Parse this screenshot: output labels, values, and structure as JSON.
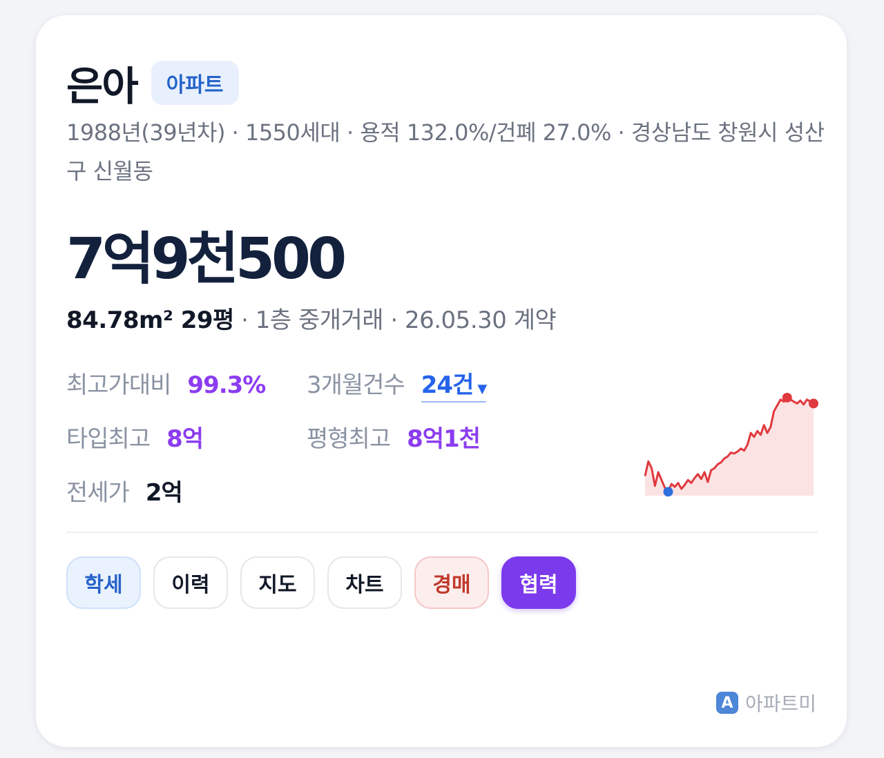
{
  "complex": {
    "name": "은아",
    "type_badge": "아파트",
    "description": "1988년(39년차) · 1550세대 · 용적 132.0%/건폐 27.0% · 경상남도 창원시 성산구 신월동"
  },
  "price": "7억9천500",
  "deal": {
    "area": "84.78m² 29평",
    "detail": " · 1층 중개거래 · 26.05.30 계약"
  },
  "stats": {
    "max_ratio_label": "최고가대비",
    "max_ratio_value": "99.3%",
    "three_month_label": "3개월건수",
    "three_month_value": "24건",
    "type_max_label": "타입최고",
    "type_max_value": "8억",
    "pyeong_max_label": "평형최고",
    "pyeong_max_value": "8억1천",
    "jeonse_label": "전세가",
    "jeonse_value": "2억"
  },
  "buttons": [
    "학세",
    "이력",
    "지도",
    "차트",
    "경매",
    "협력"
  ],
  "brand": {
    "logo_letter": "A",
    "name": "아파트미"
  },
  "colors": {
    "accent_purple": "#8b3cf0",
    "accent_blue": "#2563eb",
    "line_red": "#e0393e",
    "fill_red": "#fbe3e3"
  },
  "sparkline": {
    "values": [
      0.2,
      0.35,
      0.28,
      0.1,
      0.24,
      0.16,
      0.08,
      0.04,
      0.12,
      0.09,
      0.13,
      0.07,
      0.11,
      0.16,
      0.13,
      0.18,
      0.22,
      0.17,
      0.24,
      0.14,
      0.26,
      0.28,
      0.32,
      0.34,
      0.38,
      0.4,
      0.44,
      0.43,
      0.45,
      0.48,
      0.46,
      0.52,
      0.64,
      0.6,
      0.66,
      0.62,
      0.72,
      0.64,
      0.7,
      0.86,
      0.92,
      0.98,
      0.96,
      1.0,
      0.98,
      0.96,
      0.94,
      0.97,
      0.93,
      0.98,
      0.96,
      0.94
    ],
    "low_index": 7,
    "high_index": 43,
    "last_index": 51
  }
}
